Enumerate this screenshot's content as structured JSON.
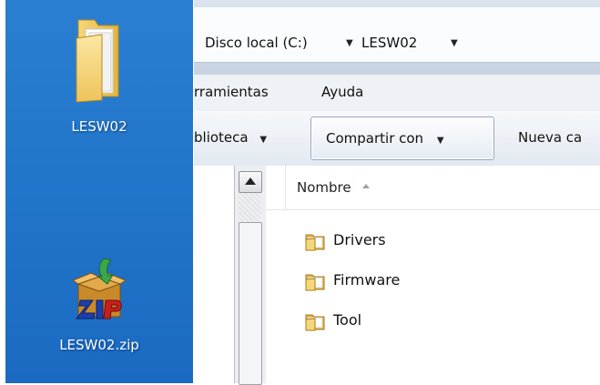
{
  "desktop": {
    "items": [
      {
        "label": "LESW02",
        "icon": "folder-icon"
      },
      {
        "label": "LESW02.zip",
        "icon": "zip-archive-icon"
      }
    ]
  },
  "addressbar": {
    "crumbs": [
      {
        "label": "Disco local (C:)"
      },
      {
        "label": "LESW02"
      }
    ]
  },
  "menubar": {
    "items": [
      "rramientas",
      "Ayuda"
    ]
  },
  "toolbar": {
    "library_label": "blioteca",
    "share_label": "Compartir con",
    "new_folder_label": "Nueva ca"
  },
  "file_list": {
    "column_name": "Nombre",
    "items": [
      {
        "name": "Drivers",
        "type": "folder"
      },
      {
        "name": "Firmware",
        "type": "folder"
      },
      {
        "name": "Tool",
        "type": "folder"
      }
    ]
  },
  "colors": {
    "desktop_blue": "#2277cb",
    "folder_yellow": "#f2c94c"
  }
}
